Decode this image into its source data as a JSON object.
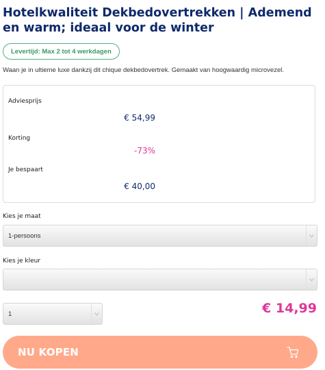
{
  "product": {
    "title": "Hotelkwaliteit Dekbedovertrekken | Ademend en warm; ideaal voor de winter",
    "delivery": "Levertijd: Max 2 tot 4 werkdagen",
    "description": "Waan je in ultieme luxe dankzij dit chique dekbedovertrek. Gemaakt van hoogwaardig microvezel."
  },
  "pricing": {
    "advice_label": "Adviesprijs",
    "advice_value": "€ 54,99",
    "discount_label": "Korting",
    "discount_value": "-73%",
    "saving_label": "Je bespaart",
    "saving_value": "€ 40,00"
  },
  "options": {
    "size_label": "Kies je maat",
    "size_value": "1-persoons",
    "color_label": "Kies je kleur",
    "color_value": "",
    "quantity_value": "1"
  },
  "price": "€ 14,99",
  "cta": {
    "label": "NU KOPEN",
    "icon": "cart-icon"
  },
  "colors": {
    "title": "#0f2a6b",
    "accent_pink": "#e0379a",
    "delivery_green": "#3a9a68",
    "button_bg": "#ffa98a"
  }
}
